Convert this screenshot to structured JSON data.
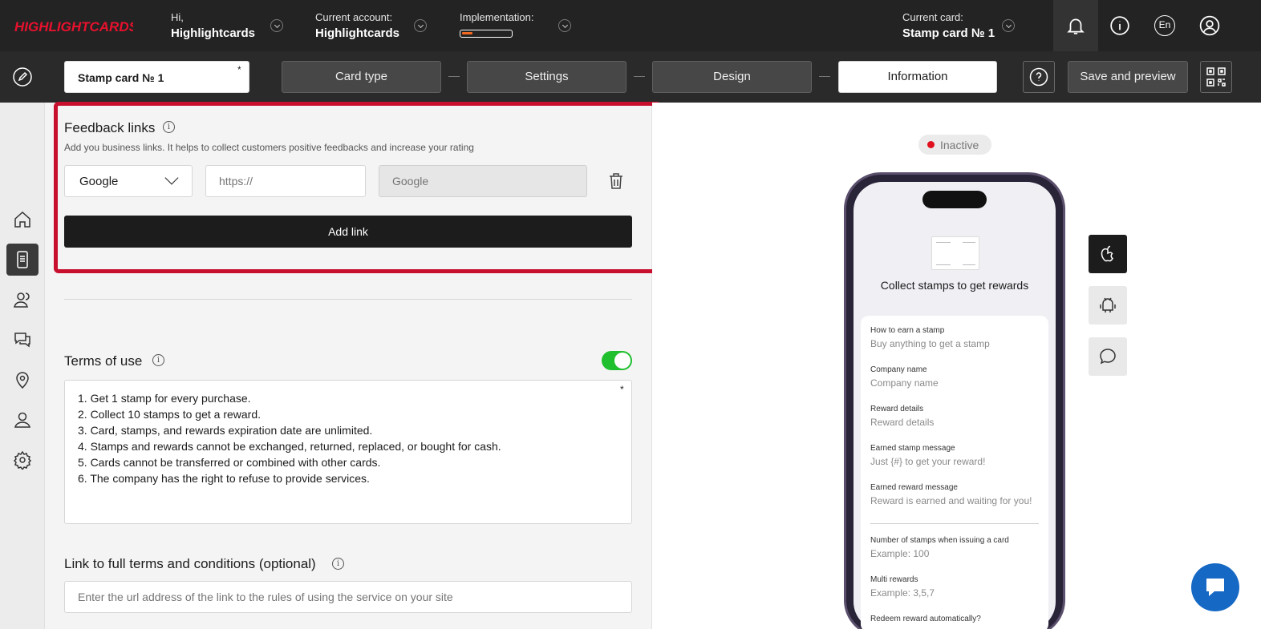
{
  "brand": {
    "logo_text": "HIGHLIGHTCARDS",
    "accent_color": "#c8102e"
  },
  "topbar": {
    "greeting_label": "Hi,",
    "greeting_name": "Highlightcards",
    "account_label": "Current account:",
    "account_name": "Highlightcards",
    "implementation_label": "Implementation:",
    "implementation_progress": 0.22,
    "current_card_label": "Current card:",
    "current_card_name": "Stamp card № 1",
    "language": "En"
  },
  "toolbar": {
    "card_name_value": "Stamp card № 1",
    "required_mark": "*",
    "steps": [
      {
        "label": "Card type"
      },
      {
        "label": "Settings"
      },
      {
        "label": "Design"
      },
      {
        "label": "Information"
      }
    ],
    "active_step": "Information",
    "save_label": "Save and preview"
  },
  "sidebar": {
    "items": [
      {
        "icon": "home-icon"
      },
      {
        "icon": "card-icon",
        "active": true
      },
      {
        "icon": "customers-icon"
      },
      {
        "icon": "messages-icon"
      },
      {
        "icon": "location-icon"
      },
      {
        "icon": "user-icon"
      },
      {
        "icon": "gear-icon"
      }
    ]
  },
  "feedback": {
    "title": "Feedback links",
    "info_glyph": "i",
    "description": "Add you business links. It helps to collect customers positive feedbacks and increase your rating",
    "platform_value": "Google",
    "url_placeholder": "https://",
    "name_placeholder": "Google",
    "add_link_label": "Add link"
  },
  "terms": {
    "title": "Terms of use",
    "enabled": true,
    "required_mark": "*",
    "lines": [
      "1. Get 1 stamp for every purchase.",
      "2. Collect 10 stamps to get a reward.",
      "3. Card, stamps, and rewards expiration date are unlimited.",
      "4. Stamps and rewards cannot be exchanged, returned, replaced, or bought for cash.",
      "5. Cards cannot be transferred or combined with other cards.",
      "6. The company has the right to refuse to provide services."
    ]
  },
  "full_terms": {
    "title": "Link to full terms and conditions (optional)",
    "placeholder": "Enter the url address of the link to the rules of using the service on your site"
  },
  "preview": {
    "status": "Inactive",
    "status_color": "#e0101e",
    "card_heading": "Collect stamps to get rewards",
    "fields": [
      {
        "label": "How to earn a stamp",
        "value": "Buy anything to get a stamp"
      },
      {
        "label": "Company name",
        "value": "Company name"
      },
      {
        "label": "Reward details",
        "value": "Reward details"
      },
      {
        "label": "Earned stamp message",
        "value": "Just {#} to get your reward!"
      },
      {
        "label": "Earned reward message",
        "value": "Reward is earned and waiting for you!"
      },
      {
        "label": "Number of stamps when issuing a card",
        "value": "Example: 100"
      },
      {
        "label": "Multi rewards",
        "value": "Example: 3,5,7"
      },
      {
        "label": "Redeem reward automatically?",
        "value": ""
      }
    ],
    "platforms": [
      {
        "icon": "apple-icon",
        "active": true
      },
      {
        "icon": "android-icon",
        "active": false
      },
      {
        "icon": "chat-bubble-icon",
        "active": false
      }
    ]
  }
}
